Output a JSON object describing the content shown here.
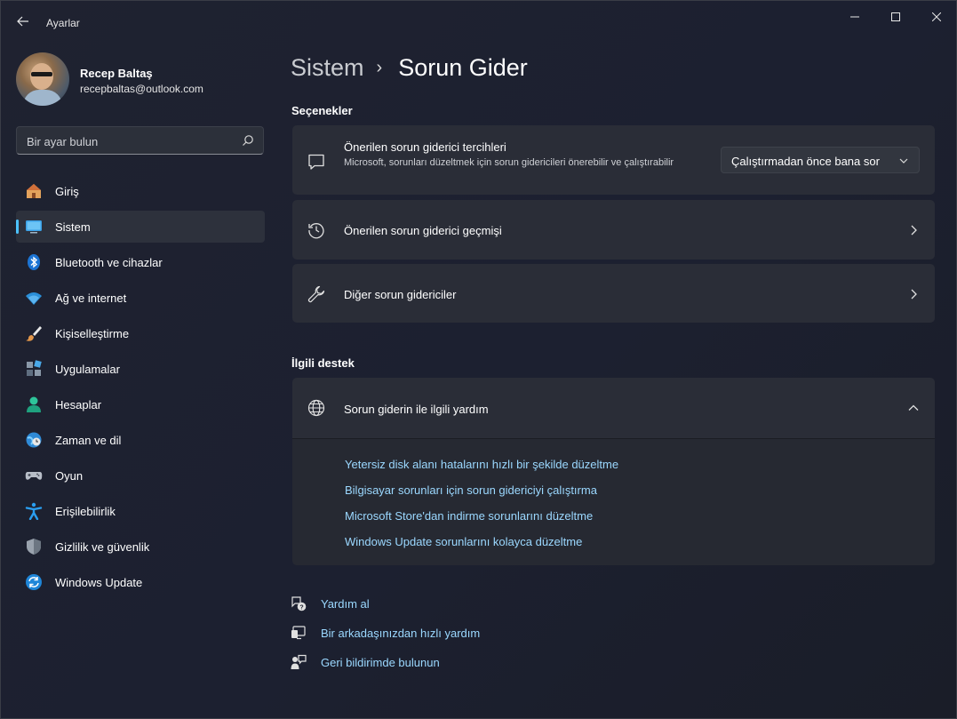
{
  "window": {
    "title": "Ayarlar",
    "controls": [
      "minimize-icon",
      "maximize-icon",
      "close-icon"
    ]
  },
  "profile": {
    "name": "Recep Baltaş",
    "email": "recepbaltas@outlook.com"
  },
  "search": {
    "placeholder": "Bir ayar bulun"
  },
  "sidebar": {
    "items": [
      {
        "label": "Giriş",
        "icon": "home-icon",
        "active": false
      },
      {
        "label": "Sistem",
        "icon": "system-display-icon",
        "active": true
      },
      {
        "label": "Bluetooth ve cihazlar",
        "icon": "bluetooth-icon",
        "active": false
      },
      {
        "label": "Ağ ve internet",
        "icon": "wifi-icon",
        "active": false
      },
      {
        "label": "Kişiselleştirme",
        "icon": "paintbrush-icon",
        "active": false
      },
      {
        "label": "Uygulamalar",
        "icon": "apps-icon",
        "active": false
      },
      {
        "label": "Hesaplar",
        "icon": "account-icon",
        "active": false
      },
      {
        "label": "Zaman ve dil",
        "icon": "globe-clock-icon",
        "active": false
      },
      {
        "label": "Oyun",
        "icon": "gamepad-icon",
        "active": false
      },
      {
        "label": "Erişilebilirlik",
        "icon": "accessibility-icon",
        "active": false
      },
      {
        "label": "Gizlilik ve güvenlik",
        "icon": "shield-icon",
        "active": false
      },
      {
        "label": "Windows Update",
        "icon": "update-icon",
        "active": false
      }
    ]
  },
  "breadcrumb": {
    "parent": "Sistem",
    "separator": "›",
    "current": "Sorun Gider"
  },
  "options": {
    "section_title": "Seçenekler",
    "recommended_prefs": {
      "title": "Önerilen sorun giderici tercihleri",
      "description": "Microsoft, sorunları düzeltmek için sorun gidericileri önerebilir ve çalıştırabilir",
      "dropdown_value": "Çalıştırmadan önce bana sor"
    },
    "history": {
      "title": "Önerilen sorun giderici geçmişi"
    },
    "other": {
      "title": "Diğer sorun gidericiler"
    }
  },
  "related": {
    "section_title": "İlgili destek",
    "help_card": {
      "title": "Sorun giderin ile ilgili yardım",
      "links": [
        "Yetersiz disk alanı hatalarını hızlı bir şekilde düzeltme",
        "Bilgisayar sorunları için sorun gidericiyi çalıştırma",
        "Microsoft Store'dan indirme sorunlarını düzeltme",
        "Windows Update sorunlarını kolayca düzeltme"
      ]
    }
  },
  "footer": {
    "get_help": "Yardım al",
    "quick_assist": "Bir arkadaşınızdan hızlı yardım",
    "feedback": "Geri bildirimde bulunun"
  },
  "colors": {
    "accent": "#4cc2ff",
    "link": "#9bd8ff",
    "card": "#2a2d37"
  }
}
